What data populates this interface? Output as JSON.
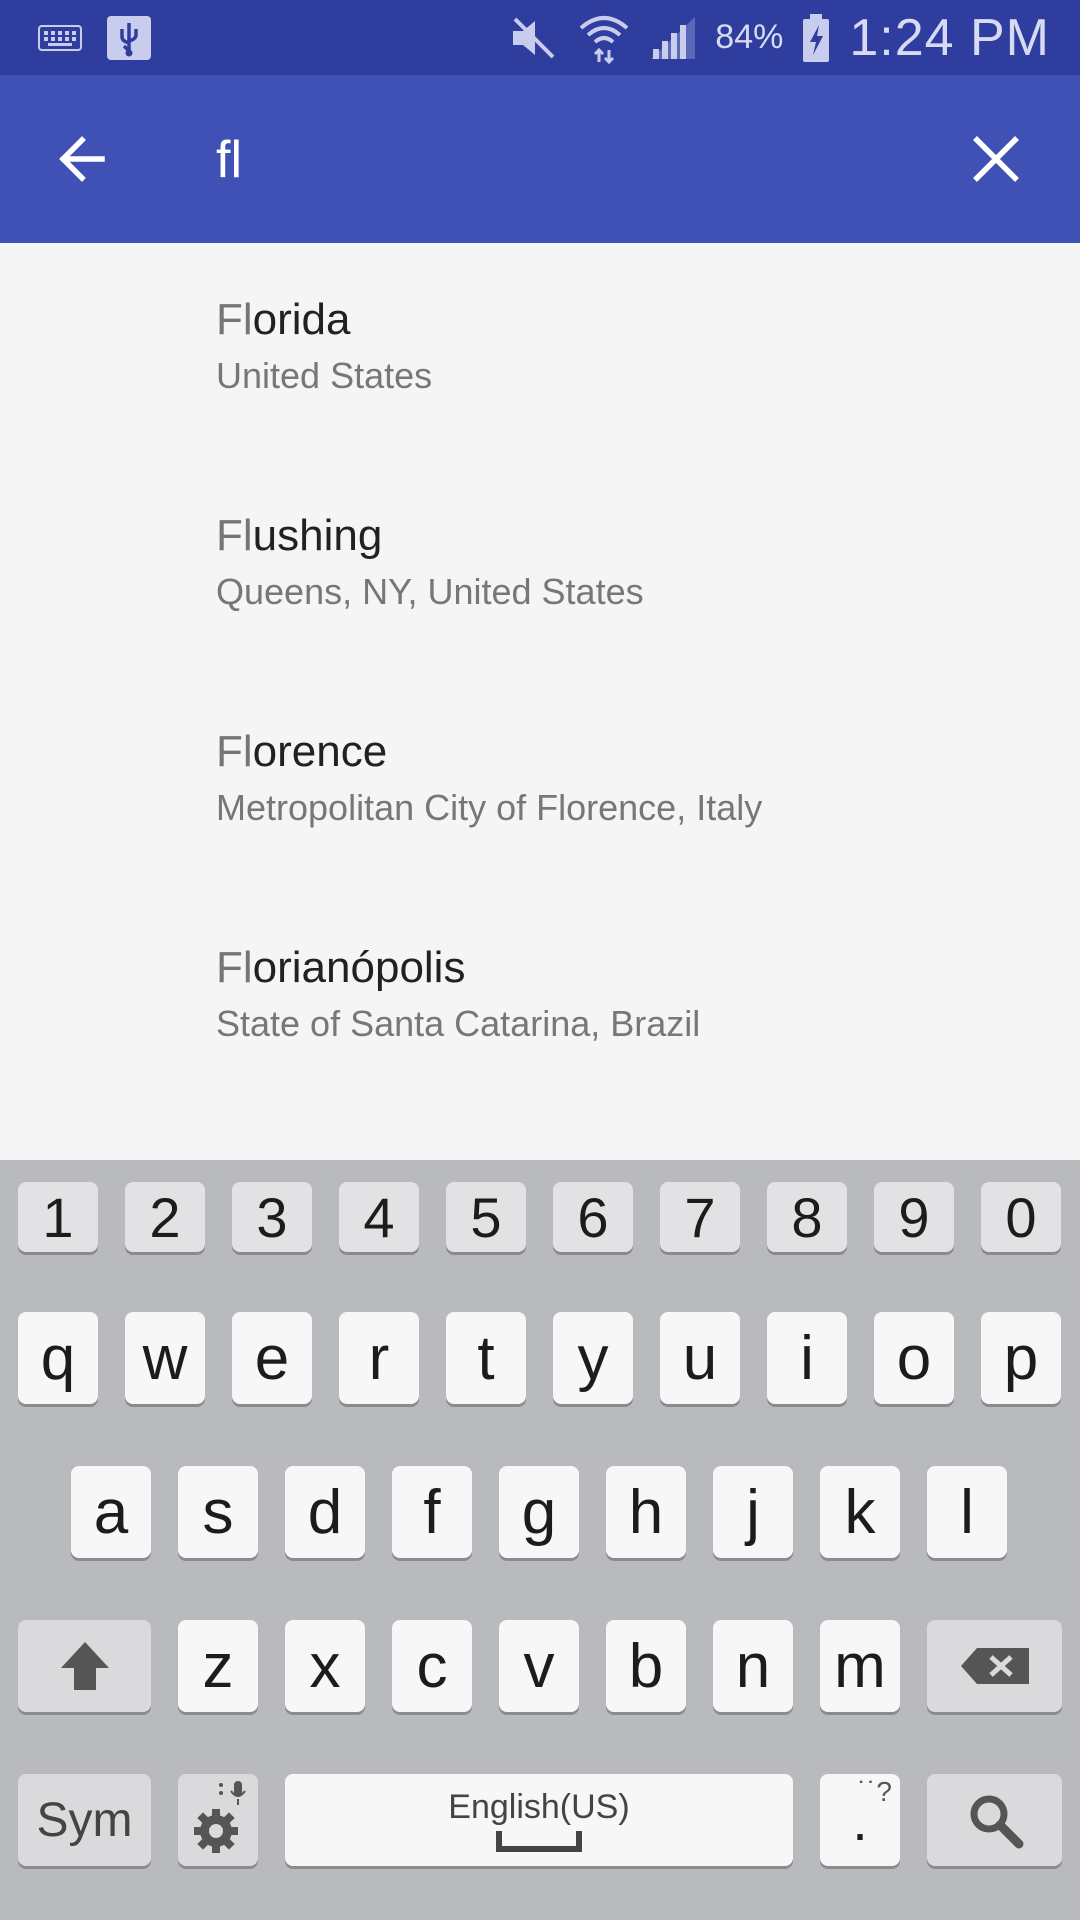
{
  "status_bar": {
    "battery": "84%",
    "time": "1:24 PM",
    "icons": [
      "keyboard-icon",
      "usb-icon",
      "mute-icon",
      "wifi-icon",
      "signal-icon",
      "battery-charging-icon"
    ]
  },
  "search": {
    "query": "fl",
    "back_icon": "arrow-left-icon",
    "clear_icon": "close-icon"
  },
  "results": [
    {
      "match": "Fl",
      "rest": "orida",
      "subtitle": "United States"
    },
    {
      "match": "Fl",
      "rest": "ushing",
      "subtitle": "Queens, NY, United States"
    },
    {
      "match": "Fl",
      "rest": "orence",
      "subtitle": "Metropolitan City of Florence, Italy"
    },
    {
      "match": "Fl",
      "rest": "orianópolis",
      "subtitle": "State of Santa Catarina, Brazil"
    }
  ],
  "keyboard": {
    "numbers": [
      "1",
      "2",
      "3",
      "4",
      "5",
      "6",
      "7",
      "8",
      "9",
      "0"
    ],
    "row1": [
      "q",
      "w",
      "e",
      "r",
      "t",
      "y",
      "u",
      "i",
      "o",
      "p"
    ],
    "row2": [
      "a",
      "s",
      "d",
      "f",
      "g",
      "h",
      "j",
      "k",
      "l"
    ],
    "row3": [
      "z",
      "x",
      "c",
      "v",
      "b",
      "n",
      "m"
    ],
    "sym_label": "Sym",
    "space_label": "English(US)",
    "period_label": ".",
    "period_alt": "˙˙?",
    "colors": {
      "background": "#b9babe",
      "key": "#f7f7f7",
      "func_key": "#dadadc"
    }
  },
  "colors": {
    "status_bar": "#2f3e9e",
    "app_bar": "#3f51b5",
    "list_bg": "#f5f5f5"
  }
}
